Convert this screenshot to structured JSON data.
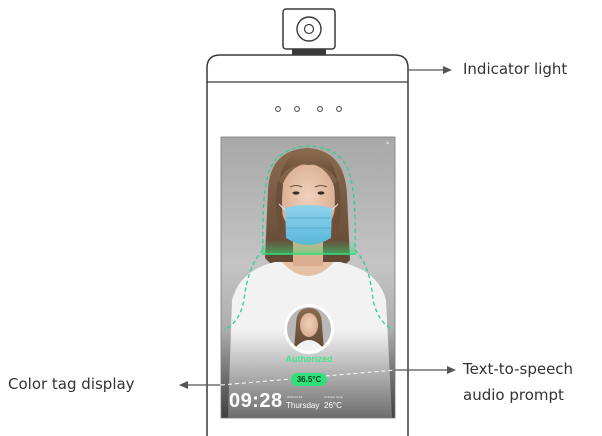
{
  "callouts": {
    "indicator_light": "Indicator light",
    "color_tag": "Color tag display",
    "tts_line1": "Text-to-speech",
    "tts_line2": "audio prompt"
  },
  "screen": {
    "time": "09:28",
    "date": "2020-04-16",
    "weekday": "Thursday",
    "ambient_label": "Ambient Temp",
    "ambient_value": "26°C",
    "status": "Authorized",
    "body_temp": "36.5°C"
  },
  "colors": {
    "face_guide": "#2fd08a",
    "temp_badge": "#2fe07a",
    "device_outline": "#3a3a3a",
    "arrow": "#555555"
  },
  "icons": [
    "camera-lens-icon",
    "person-avatar-icon"
  ]
}
